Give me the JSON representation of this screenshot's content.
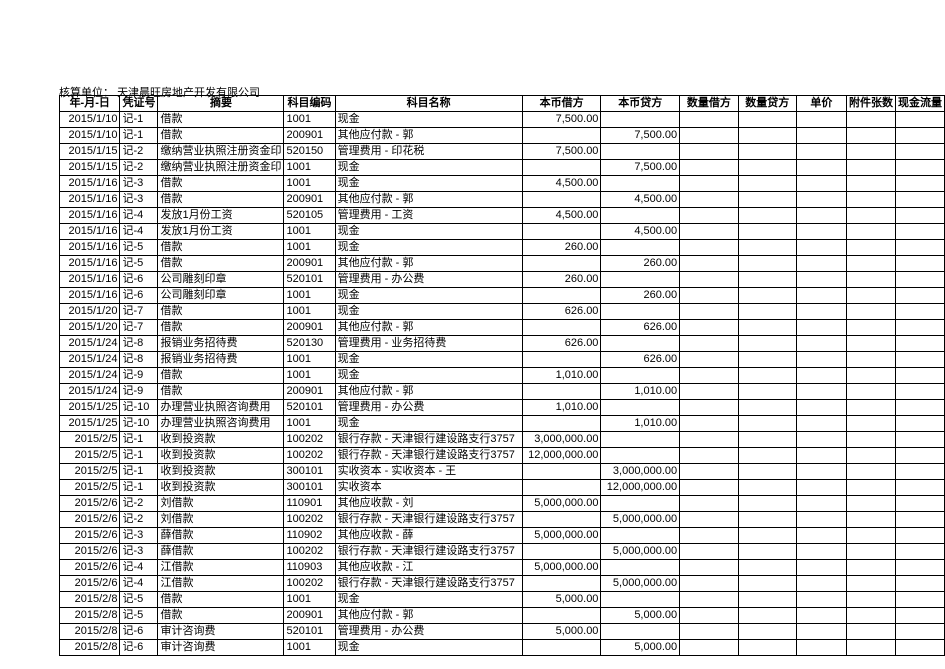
{
  "header": {
    "label": "核算单位：",
    "unit": "天津晨旺房地产开发有限公司"
  },
  "columns": [
    "年-月-日",
    "凭证号",
    "摘要",
    "科目编码",
    "科目名称",
    "本币借方",
    "本币贷方",
    "数量借方",
    "数量贷方",
    "单价",
    "附件张数",
    "现金流量"
  ],
  "rows": [
    {
      "date": "2015/1/10",
      "vno": "记-1",
      "summary": "借款",
      "code": "1001",
      "name": "现金",
      "debit": "7,500.00",
      "credit": "",
      "qd": "",
      "qc": "",
      "price": "",
      "att": "",
      "cash": ""
    },
    {
      "date": "2015/1/10",
      "vno": "记-1",
      "summary": "借款",
      "code": "200901",
      "name": "其他应付款 - 郭",
      "debit": "",
      "credit": "7,500.00",
      "qd": "",
      "qc": "",
      "price": "",
      "att": "",
      "cash": ""
    },
    {
      "date": "2015/1/15",
      "vno": "记-2",
      "summary": "缴纳营业执照注册资金印",
      "code": "520150",
      "name": "管理费用 - 印花税",
      "debit": "7,500.00",
      "credit": "",
      "qd": "",
      "qc": "",
      "price": "",
      "att": "",
      "cash": ""
    },
    {
      "date": "2015/1/15",
      "vno": "记-2",
      "summary": "缴纳营业执照注册资金印",
      "code": "1001",
      "name": "现金",
      "debit": "",
      "credit": "7,500.00",
      "qd": "",
      "qc": "",
      "price": "",
      "att": "",
      "cash": ""
    },
    {
      "date": "2015/1/16",
      "vno": "记-3",
      "summary": "借款",
      "code": "1001",
      "name": "现金",
      "debit": "4,500.00",
      "credit": "",
      "qd": "",
      "qc": "",
      "price": "",
      "att": "",
      "cash": ""
    },
    {
      "date": "2015/1/16",
      "vno": "记-3",
      "summary": "借款",
      "code": "200901",
      "name": "其他应付款 - 郭",
      "debit": "",
      "credit": "4,500.00",
      "qd": "",
      "qc": "",
      "price": "",
      "att": "",
      "cash": ""
    },
    {
      "date": "2015/1/16",
      "vno": "记-4",
      "summary": "发放1月份工资",
      "code": "520105",
      "name": "管理费用 - 工资",
      "debit": "4,500.00",
      "credit": "",
      "qd": "",
      "qc": "",
      "price": "",
      "att": "",
      "cash": ""
    },
    {
      "date": "2015/1/16",
      "vno": "记-4",
      "summary": "发放1月份工资",
      "code": "1001",
      "name": "现金",
      "debit": "",
      "credit": "4,500.00",
      "qd": "",
      "qc": "",
      "price": "",
      "att": "",
      "cash": ""
    },
    {
      "date": "2015/1/16",
      "vno": "记-5",
      "summary": "借款",
      "code": "1001",
      "name": "现金",
      "debit": "260.00",
      "credit": "",
      "qd": "",
      "qc": "",
      "price": "",
      "att": "",
      "cash": ""
    },
    {
      "date": "2015/1/16",
      "vno": "记-5",
      "summary": "借款",
      "code": "200901",
      "name": "其他应付款 - 郭",
      "debit": "",
      "credit": "260.00",
      "qd": "",
      "qc": "",
      "price": "",
      "att": "",
      "cash": ""
    },
    {
      "date": "2015/1/16",
      "vno": "记-6",
      "summary": "公司雕刻印章",
      "code": "520101",
      "name": "管理费用 - 办公费",
      "debit": "260.00",
      "credit": "",
      "qd": "",
      "qc": "",
      "price": "",
      "att": "",
      "cash": ""
    },
    {
      "date": "2015/1/16",
      "vno": "记-6",
      "summary": "公司雕刻印章",
      "code": "1001",
      "name": "现金",
      "debit": "",
      "credit": "260.00",
      "qd": "",
      "qc": "",
      "price": "",
      "att": "",
      "cash": ""
    },
    {
      "date": "2015/1/20",
      "vno": "记-7",
      "summary": "借款",
      "code": "1001",
      "name": "现金",
      "debit": "626.00",
      "credit": "",
      "qd": "",
      "qc": "",
      "price": "",
      "att": "",
      "cash": ""
    },
    {
      "date": "2015/1/20",
      "vno": "记-7",
      "summary": "借款",
      "code": "200901",
      "name": "其他应付款 - 郭",
      "debit": "",
      "credit": "626.00",
      "qd": "",
      "qc": "",
      "price": "",
      "att": "",
      "cash": ""
    },
    {
      "date": "2015/1/24",
      "vno": "记-8",
      "summary": "报销业务招待费",
      "code": "520130",
      "name": "管理费用 - 业务招待费",
      "debit": "626.00",
      "credit": "",
      "qd": "",
      "qc": "",
      "price": "",
      "att": "",
      "cash": ""
    },
    {
      "date": "2015/1/24",
      "vno": "记-8",
      "summary": "报销业务招待费",
      "code": "1001",
      "name": "现金",
      "debit": "",
      "credit": "626.00",
      "qd": "",
      "qc": "",
      "price": "",
      "att": "",
      "cash": ""
    },
    {
      "date": "2015/1/24",
      "vno": "记-9",
      "summary": "借款",
      "code": "1001",
      "name": "现金",
      "debit": "1,010.00",
      "credit": "",
      "qd": "",
      "qc": "",
      "price": "",
      "att": "",
      "cash": ""
    },
    {
      "date": "2015/1/24",
      "vno": "记-9",
      "summary": "借款",
      "code": "200901",
      "name": "其他应付款 - 郭",
      "debit": "",
      "credit": "1,010.00",
      "qd": "",
      "qc": "",
      "price": "",
      "att": "",
      "cash": ""
    },
    {
      "date": "2015/1/25",
      "vno": "记-10",
      "summary": "办理营业执照咨询费用",
      "code": "520101",
      "name": "管理费用 - 办公费",
      "debit": "1,010.00",
      "credit": "",
      "qd": "",
      "qc": "",
      "price": "",
      "att": "",
      "cash": ""
    },
    {
      "date": "2015/1/25",
      "vno": "记-10",
      "summary": "办理营业执照咨询费用",
      "code": "1001",
      "name": "现金",
      "debit": "",
      "credit": "1,010.00",
      "qd": "",
      "qc": "",
      "price": "",
      "att": "",
      "cash": ""
    },
    {
      "date": "2015/2/5",
      "vno": "记-1",
      "summary": "收到投资款",
      "code": "100202",
      "name": "银行存款 - 天津银行建设路支行3757",
      "debit": "3,000,000.00",
      "credit": "",
      "qd": "",
      "qc": "",
      "price": "",
      "att": "",
      "cash": ""
    },
    {
      "date": "2015/2/5",
      "vno": "记-1",
      "summary": "收到投资款",
      "code": "100202",
      "name": "银行存款 - 天津银行建设路支行3757",
      "debit": "12,000,000.00",
      "credit": "",
      "qd": "",
      "qc": "",
      "price": "",
      "att": "",
      "cash": ""
    },
    {
      "date": "2015/2/5",
      "vno": "记-1",
      "summary": "收到投资款",
      "code": "300101",
      "name": "实收资本 - 实收资本 - 王",
      "debit": "",
      "credit": "3,000,000.00",
      "qd": "",
      "qc": "",
      "price": "",
      "att": "",
      "cash": ""
    },
    {
      "date": "2015/2/5",
      "vno": "记-1",
      "summary": "收到投资款",
      "code": "300101",
      "name": "实收资本",
      "debit": "",
      "credit": "12,000,000.00",
      "qd": "",
      "qc": "",
      "price": "",
      "att": "",
      "cash": ""
    },
    {
      "date": "2015/2/6",
      "vno": "记-2",
      "summary": "刘借款",
      "code": "110901",
      "name": "其他应收款 - 刘",
      "debit": "5,000,000.00",
      "credit": "",
      "qd": "",
      "qc": "",
      "price": "",
      "att": "",
      "cash": ""
    },
    {
      "date": "2015/2/6",
      "vno": "记-2",
      "summary": "刘借款",
      "code": "100202",
      "name": "银行存款 - 天津银行建设路支行3757",
      "debit": "",
      "credit": "5,000,000.00",
      "qd": "",
      "qc": "",
      "price": "",
      "att": "",
      "cash": ""
    },
    {
      "date": "2015/2/6",
      "vno": "记-3",
      "summary": "薛借款",
      "code": "110902",
      "name": "其他应收款 - 薛",
      "debit": "5,000,000.00",
      "credit": "",
      "qd": "",
      "qc": "",
      "price": "",
      "att": "",
      "cash": ""
    },
    {
      "date": "2015/2/6",
      "vno": "记-3",
      "summary": "薛借款",
      "code": "100202",
      "name": "银行存款 - 天津银行建设路支行3757",
      "debit": "",
      "credit": "5,000,000.00",
      "qd": "",
      "qc": "",
      "price": "",
      "att": "",
      "cash": ""
    },
    {
      "date": "2015/2/6",
      "vno": "记-4",
      "summary": "江借款",
      "code": "110903",
      "name": "其他应收款 - 江",
      "debit": "5,000,000.00",
      "credit": "",
      "qd": "",
      "qc": "",
      "price": "",
      "att": "",
      "cash": ""
    },
    {
      "date": "2015/2/6",
      "vno": "记-4",
      "summary": "江借款",
      "code": "100202",
      "name": "银行存款 - 天津银行建设路支行3757",
      "debit": "",
      "credit": "5,000,000.00",
      "qd": "",
      "qc": "",
      "price": "",
      "att": "",
      "cash": ""
    },
    {
      "date": "2015/2/8",
      "vno": "记-5",
      "summary": "借款",
      "code": "1001",
      "name": "现金",
      "debit": "5,000.00",
      "credit": "",
      "qd": "",
      "qc": "",
      "price": "",
      "att": "",
      "cash": ""
    },
    {
      "date": "2015/2/8",
      "vno": "记-5",
      "summary": "借款",
      "code": "200901",
      "name": "其他应付款 - 郭",
      "debit": "",
      "credit": "5,000.00",
      "qd": "",
      "qc": "",
      "price": "",
      "att": "",
      "cash": ""
    },
    {
      "date": "2015/2/8",
      "vno": "记-6",
      "summary": "审计咨询费",
      "code": "520101",
      "name": "管理费用 - 办公费",
      "debit": "5,000.00",
      "credit": "",
      "qd": "",
      "qc": "",
      "price": "",
      "att": "",
      "cash": ""
    },
    {
      "date": "2015/2/8",
      "vno": "记-6",
      "summary": "审计咨询费",
      "code": "1001",
      "name": "现金",
      "debit": "",
      "credit": "5,000.00",
      "qd": "",
      "qc": "",
      "price": "",
      "att": "",
      "cash": ""
    }
  ]
}
